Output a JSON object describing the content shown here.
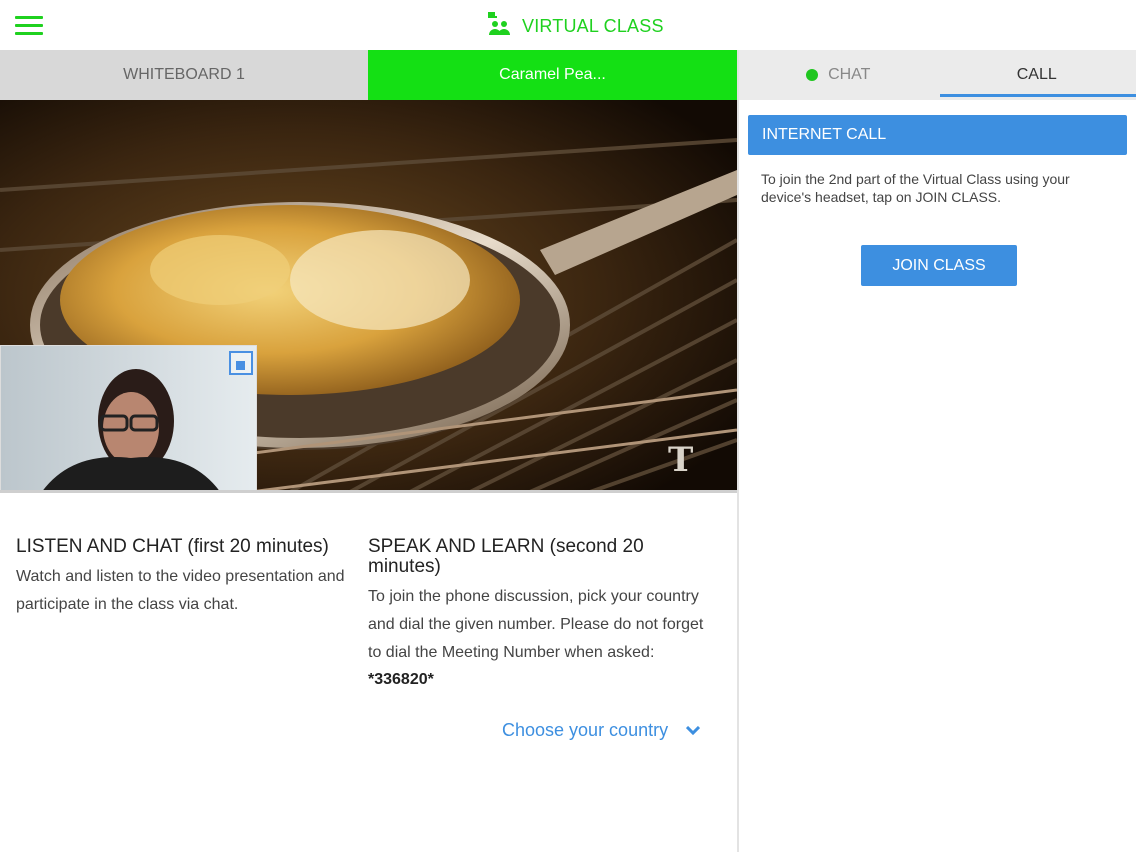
{
  "header": {
    "title": "VIRTUAL CLASS",
    "brand_color": "#1fd11f",
    "menu_icon": "hamburger-menu-icon",
    "logo_icon": "people-icon"
  },
  "left_tabs": [
    {
      "label": "WHITEBOARD 1",
      "active": false
    },
    {
      "label": "Caramel Pea...",
      "active": true
    }
  ],
  "right_tabs": [
    {
      "label": "CHAT",
      "active": false,
      "status": "online"
    },
    {
      "label": "CALL",
      "active": true
    }
  ],
  "video": {
    "watermark": "T"
  },
  "sections": {
    "listen": {
      "title": "LISTEN AND CHAT (first 20 minutes)",
      "text": "Watch and listen to the video presentation and participate in the class via chat."
    },
    "speak": {
      "title": "SPEAK AND LEARN (second 20 minutes)",
      "text": "To join the phone discussion, pick your country and dial the given number. Please do not forget to dial the Meeting Number when asked:",
      "meeting_number": "*336820*",
      "country_select": "Choose your country"
    }
  },
  "call_panel": {
    "header": "INTERNET CALL",
    "description": "To join the 2nd part of the Virtual Class using your device's headset, tap on JOIN CLASS.",
    "join_button": "JOIN CLASS",
    "accent": "#3d8fe0"
  }
}
